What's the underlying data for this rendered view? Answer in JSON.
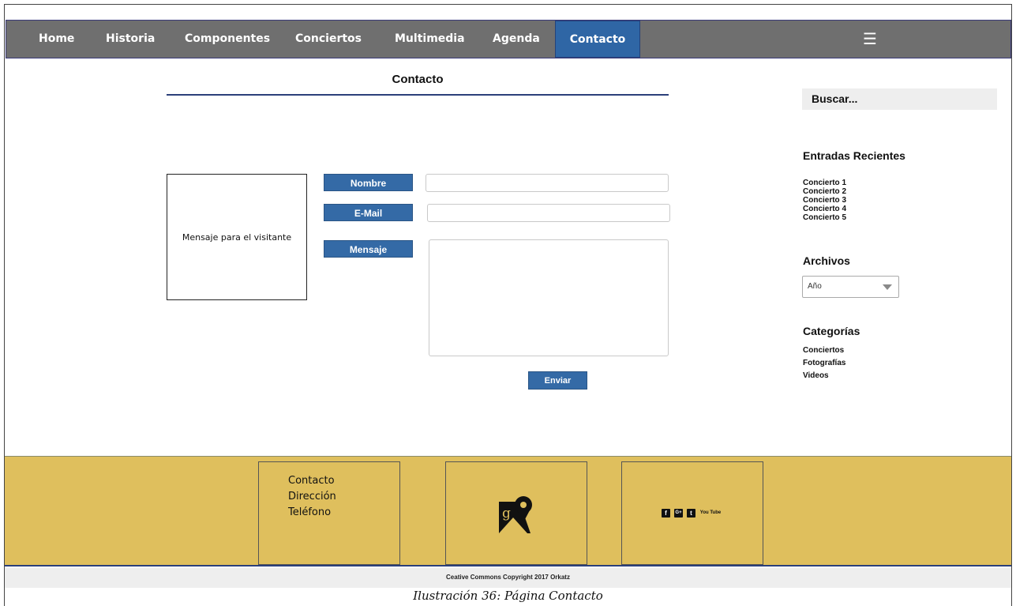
{
  "nav": {
    "items": [
      {
        "label": "Home",
        "active": false
      },
      {
        "label": "Historia",
        "active": false
      },
      {
        "label": "Componentes",
        "active": false
      },
      {
        "label": "Conciertos",
        "active": false
      },
      {
        "label": "Multimedia",
        "active": false
      },
      {
        "label": "Agenda",
        "active": false
      },
      {
        "label": "Contacto",
        "active": true
      }
    ],
    "menu_icon": "hamburger-icon",
    "menu_glyph": "☰"
  },
  "main": {
    "title": "Contacto",
    "message_box_text": "Mensaje para el visitante",
    "form": {
      "name_label": "Nombre",
      "email_label": "E-Mail",
      "message_label": "Mensaje",
      "name_value": "",
      "email_value": "",
      "message_value": "",
      "send_label": "Enviar"
    }
  },
  "sidebar": {
    "search_label": "Buscar...",
    "recent_heading": "Entradas Recientes",
    "recent_entries": [
      "Concierto 1",
      "Concierto 2",
      "Concierto 3",
      "Concierto 4",
      "Concierto 5"
    ],
    "archives_heading": "Archivos",
    "year_select": "Año",
    "categories_heading": "Categorías",
    "categories": [
      "Conciertos",
      "Fotografías",
      "Videos"
    ]
  },
  "footer": {
    "links": [
      "Contacto",
      "Dirección",
      "Teléfono"
    ],
    "map_icon": "google-maps-icon",
    "social_icons": [
      "facebook-icon",
      "google-plus-icon",
      "twitter-icon",
      "youtube-icon"
    ],
    "social_glyphs": {
      "facebook": "f",
      "google_plus": "G+",
      "twitter": "t",
      "youtube": "You Tube"
    },
    "copyright": "Ceative Commons Copyright 2017 Orkatz"
  },
  "caption": "Ilustración 36: Página Contacto",
  "colors": {
    "nav_bg": "#6f6f6f",
    "accent_blue": "#346aa6",
    "footer_bg": "#dfbf5d",
    "rule": "#2b3f7a"
  }
}
